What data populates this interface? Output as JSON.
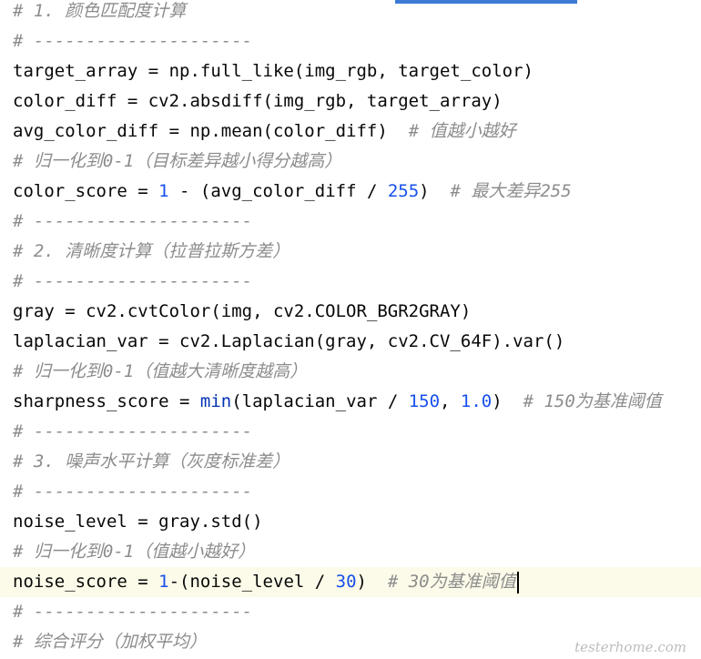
{
  "lines": [
    {
      "c": "# 1. 颜色匹配度计算"
    },
    {
      "c": "# ---------------------"
    },
    {
      "a": "target_array = np.full_like(img_rgb, target_color)"
    },
    {
      "a": "color_diff = cv2.absdiff(img_rgb, target_array)"
    },
    {
      "a": "avg_color_diff = np.mean(color_diff)  ",
      "c": "# 值越小越好"
    },
    {
      "c": "# 归一化到0-1（目标差异越小得分越高）"
    },
    {
      "a": "color_score = ",
      "n1": "1",
      "b": " - (avg_color_diff / ",
      "n2": "255",
      "d": ")  ",
      "c": "# 最大差异255"
    },
    {
      "c": "# ---------------------"
    },
    {
      "c": "# 2. 清晰度计算（拉普拉斯方差）"
    },
    {
      "c": "# ---------------------"
    },
    {
      "a": "gray = cv2.cvtColor(img, cv2.COLOR_BGR2GRAY)"
    },
    {
      "a": "laplacian_var = cv2.Laplacian(gray, cv2.CV_64F).var()"
    },
    {
      "c": "# 归一化到0-1（值越大清晰度越高）"
    },
    {
      "a": "sharpness_score = ",
      "f": "min",
      "b": "(laplacian_var / ",
      "n1": "150",
      "e": ", ",
      "n2": "1.0",
      "d": ")  ",
      "c": "# 150为基准阈值"
    },
    {
      "c": "# ---------------------"
    },
    {
      "c": "# 3. 噪声水平计算（灰度标准差）"
    },
    {
      "c": "# ---------------------"
    },
    {
      "a": "noise_level = gray.std()"
    },
    {
      "c": "# 归一化到0-1（值越小越好）"
    },
    {
      "a": "noise_score = ",
      "n1": "1",
      "b": "-(noise_level / ",
      "n2": "30",
      "d": ")  ",
      "c": "# 30为基准阈值"
    },
    {
      "c": "# ---------------------"
    },
    {
      "c": "# 综合评分（加权平均）"
    }
  ],
  "watermark": "testerhome.com"
}
